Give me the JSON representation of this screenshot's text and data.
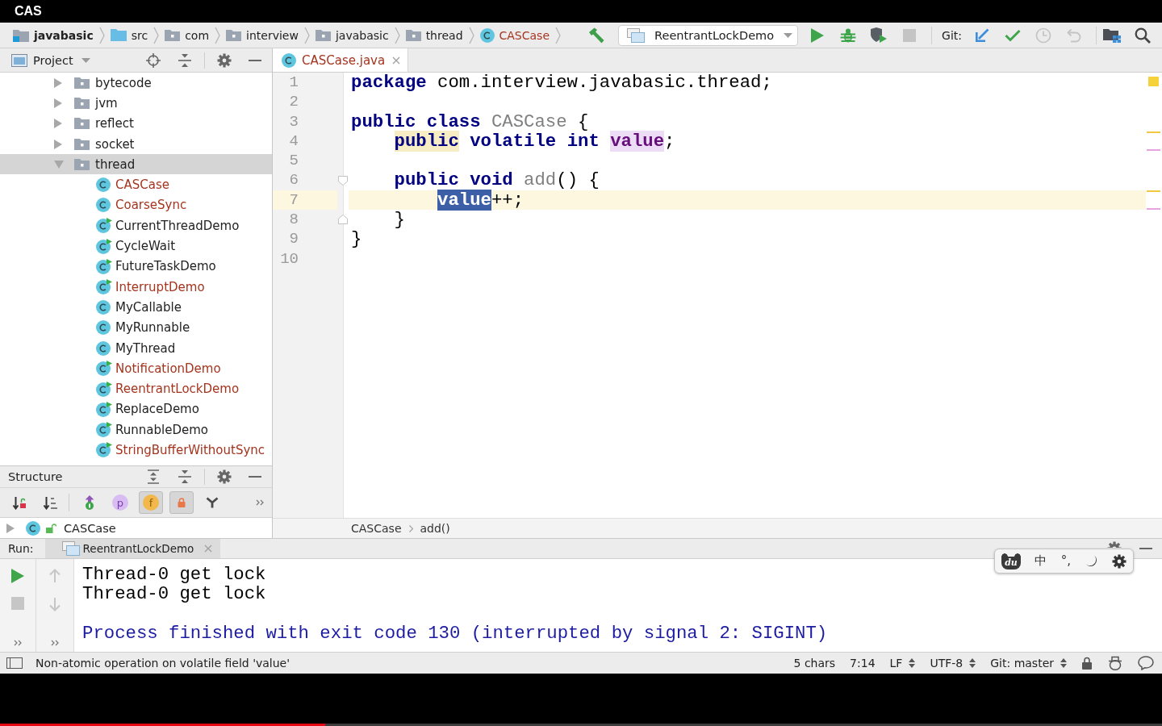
{
  "player": {
    "title": "CAS",
    "progress": {
      "level": 0.28
    }
  },
  "navigation_bar": {
    "breadcrumbs": [
      {
        "label": "javabasic",
        "kind": "module",
        "untracked": false
      },
      {
        "label": "src",
        "kind": "source-folder",
        "untracked": false
      },
      {
        "label": "com",
        "kind": "package",
        "untracked": false
      },
      {
        "label": "interview",
        "kind": "package",
        "untracked": false
      },
      {
        "label": "javabasic",
        "kind": "package",
        "untracked": false
      },
      {
        "label": "thread",
        "kind": "package",
        "untracked": false
      },
      {
        "label": "CASCase",
        "kind": "class",
        "untracked": true
      }
    ],
    "toolbar_groups": [
      [
        {
          "kind": "build",
          "disabled": false
        },
        {
          "kind": "run-config",
          "label": "ReentrantLockDemo",
          "disabled": false
        },
        {
          "kind": "run",
          "disabled": false
        },
        {
          "kind": "debug",
          "disabled": false
        },
        {
          "kind": "coverage",
          "disabled": false
        },
        {
          "kind": "stop",
          "disabled": true
        }
      ],
      [
        {
          "kind": "label",
          "label": "Git:",
          "disabled": false
        },
        {
          "kind": "vcs-update",
          "disabled": false
        },
        {
          "kind": "vcs-commit",
          "disabled": false
        },
        {
          "kind": "vcs-history",
          "disabled": true
        },
        {
          "kind": "vcs-revert",
          "disabled": true
        }
      ],
      [
        {
          "kind": "project-structure",
          "disabled": false
        },
        {
          "kind": "search",
          "disabled": false
        }
      ]
    ]
  },
  "project_panel": {
    "title": "Project",
    "tree": [
      {
        "label": "bytecode",
        "kind": "package",
        "expanded": false,
        "selected": false,
        "untracked": false
      },
      {
        "label": "jvm",
        "kind": "package",
        "expanded": false,
        "selected": false,
        "untracked": false
      },
      {
        "label": "reflect",
        "kind": "package",
        "expanded": false,
        "selected": false,
        "untracked": false
      },
      {
        "label": "socket",
        "kind": "package",
        "expanded": false,
        "selected": false,
        "untracked": false
      },
      {
        "label": "thread",
        "kind": "package",
        "expanded": true,
        "selected": true,
        "untracked": false,
        "children": [
          {
            "label": "CASCase",
            "kind": "class",
            "selected": false,
            "untracked": true
          },
          {
            "label": "CoarseSync",
            "kind": "class",
            "selected": false,
            "untracked": true
          },
          {
            "label": "CurrentThreadDemo",
            "kind": "runnable-class",
            "selected": false,
            "untracked": false
          },
          {
            "label": "CycleWait",
            "kind": "runnable-class",
            "selected": false,
            "untracked": false
          },
          {
            "label": "FutureTaskDemo",
            "kind": "runnable-class",
            "selected": false,
            "untracked": false
          },
          {
            "label": "InterruptDemo",
            "kind": "runnable-class",
            "selected": false,
            "untracked": true
          },
          {
            "label": "MyCallable",
            "kind": "class",
            "selected": false,
            "untracked": false
          },
          {
            "label": "MyRunnable",
            "kind": "class",
            "selected": false,
            "untracked": false
          },
          {
            "label": "MyThread",
            "kind": "class",
            "selected": false,
            "untracked": false
          },
          {
            "label": "NotificationDemo",
            "kind": "runnable-class",
            "selected": false,
            "untracked": true
          },
          {
            "label": "ReentrantLockDemo",
            "kind": "runnable-class",
            "selected": false,
            "untracked": true
          },
          {
            "label": "ReplaceDemo",
            "kind": "runnable-class",
            "selected": false,
            "untracked": false
          },
          {
            "label": "RunnableDemo",
            "kind": "runnable-class",
            "selected": false,
            "untracked": false
          },
          {
            "label": "StringBufferWithoutSync",
            "kind": "runnable-class",
            "selected": false,
            "untracked": true
          }
        ]
      }
    ]
  },
  "structure_panel": {
    "title": "Structure",
    "toolbar_groups": [
      [
        {
          "kind": "sort-visibility",
          "selected": false
        },
        {
          "kind": "sort-alpha",
          "selected": false
        }
      ],
      [
        {
          "kind": "inherited",
          "selected": false
        },
        {
          "kind": "properties",
          "glyph": "p",
          "selected": false
        },
        {
          "kind": "fields",
          "glyph": "f",
          "selected": true
        },
        {
          "kind": "non-public",
          "selected": true
        },
        {
          "kind": "hierarchy",
          "selected": false
        }
      ]
    ],
    "tree": [
      {
        "label": "CASCase",
        "kind": "class",
        "expanded": false,
        "selected": false,
        "untracked": false
      }
    ]
  },
  "editor": {
    "tabs": [
      {
        "label": "CASCase.java",
        "kind": "class",
        "selected": true,
        "untracked": true
      }
    ],
    "inspection": {
      "kind": "warning"
    },
    "lines": [
      {
        "number": "1",
        "current": false,
        "tokens": [
          {
            "text": "package",
            "kind": "keyword"
          },
          {
            "text": " com.interview.javabasic.thread;",
            "kind": "plain"
          }
        ]
      },
      {
        "number": "2",
        "current": false
      },
      {
        "number": "3",
        "current": false,
        "tokens": [
          {
            "text": "public class",
            "kind": "keyword"
          },
          {
            "text": " CASCase",
            "kind": "unused"
          },
          {
            "text": " {",
            "kind": "plain"
          }
        ]
      },
      {
        "number": "4",
        "current": false,
        "marks": [
          {
            "kind": "warning"
          },
          {
            "kind": "usage"
          }
        ],
        "tokens": [
          {
            "text": "    public",
            "kind": "keyword",
            "warning": true
          },
          {
            "text": " volatile int ",
            "kind": "keyword"
          },
          {
            "text": "value",
            "kind": "field",
            "usage": true
          },
          {
            "text": ";",
            "kind": "plain"
          }
        ]
      },
      {
        "number": "5",
        "current": false
      },
      {
        "number": "6",
        "current": false,
        "fold_start": true,
        "tokens": [
          {
            "text": "    public void",
            "kind": "keyword"
          },
          {
            "text": " add",
            "kind": "unused"
          },
          {
            "text": "() {",
            "kind": "plain"
          }
        ]
      },
      {
        "number": "7",
        "current": true,
        "marks": [
          {
            "kind": "warning"
          },
          {
            "kind": "usage"
          }
        ],
        "tokens": [
          {
            "text": "        value",
            "kind": "field",
            "selected": true
          },
          {
            "text": "++;",
            "kind": "plain"
          }
        ]
      },
      {
        "number": "8",
        "current": false,
        "fold_end": true,
        "tokens": [
          {
            "text": "    }",
            "kind": "plain"
          }
        ]
      },
      {
        "number": "9",
        "current": false,
        "tokens": [
          {
            "text": "}",
            "kind": "plain"
          }
        ]
      },
      {
        "number": "10",
        "current": false
      }
    ],
    "breadcrumbs": [
      "CASCase",
      "add()"
    ]
  },
  "run_panel": {
    "label": "Run:",
    "tabs": [
      {
        "label": "ReentrantLockDemo",
        "selected": true
      }
    ],
    "toolbar_columns": [
      [
        {
          "kind": "rerun",
          "disabled": false
        },
        {
          "kind": "stop",
          "disabled": true
        }
      ],
      [
        {
          "kind": "previous",
          "disabled": true
        },
        {
          "kind": "next",
          "disabled": true
        }
      ]
    ],
    "console": [
      {
        "kind": "stdout",
        "text": "Thread-0 get lock"
      },
      {
        "kind": "stdout",
        "text": "Thread-0 get lock"
      },
      {
        "kind": "blank"
      },
      {
        "kind": "system",
        "text": "Process finished with exit code 130 (interrupted by signal 2: SIGINT)"
      }
    ]
  },
  "status_bar": {
    "message": "Non-atomic operation on volatile field 'value'",
    "items": [
      {
        "kind": "text",
        "label": "5 chars"
      },
      {
        "kind": "text",
        "label": "7:14"
      },
      {
        "kind": "dropdown",
        "label": "LF"
      },
      {
        "kind": "dropdown",
        "label": "UTF-8"
      },
      {
        "kind": "dropdown",
        "label": "Git: master"
      },
      {
        "kind": "lock"
      },
      {
        "kind": "inspector"
      },
      {
        "kind": "event-log"
      }
    ]
  },
  "ime_toolbar": {
    "items": [
      {
        "kind": "logo",
        "text": "du"
      },
      {
        "kind": "mode",
        "text": "中"
      },
      {
        "kind": "punctuation",
        "text": "°,"
      },
      {
        "kind": "night-mode"
      },
      {
        "kind": "settings"
      }
    ]
  }
}
